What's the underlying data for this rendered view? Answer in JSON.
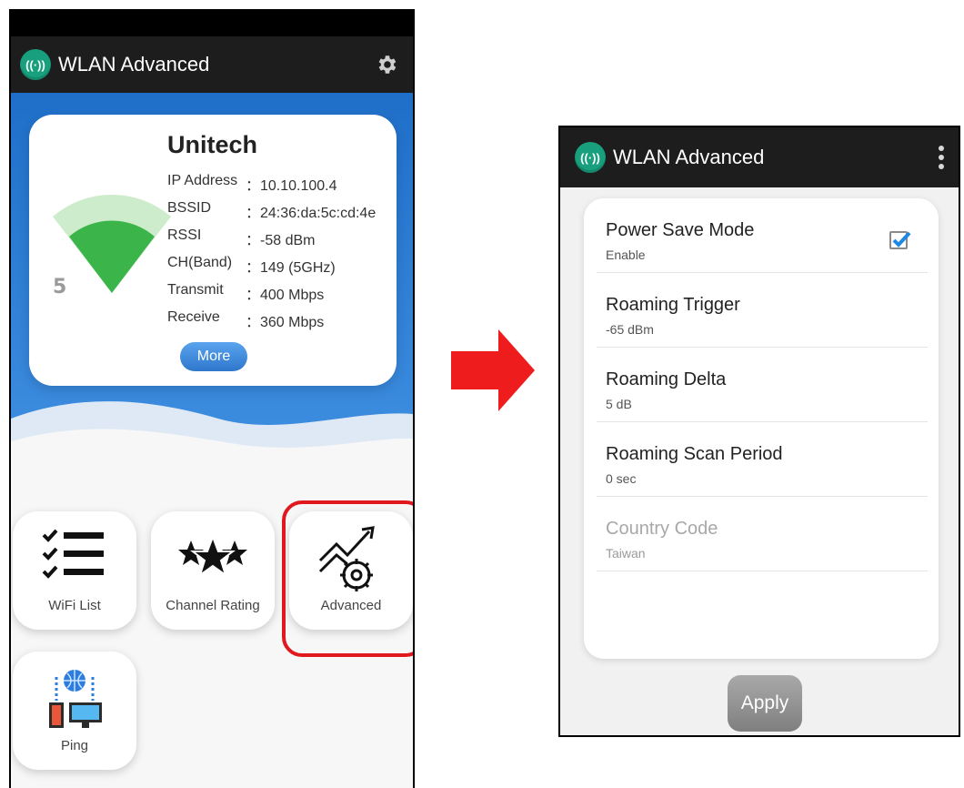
{
  "left_screen": {
    "app_title": "WLAN Advanced",
    "logo_glyph": "((·))",
    "settings_icon": "gear-icon",
    "network": {
      "ssid": "Unitech",
      "rows": [
        {
          "label": "IP Address",
          "value": "：10.10.100.4"
        },
        {
          "label": "BSSID",
          "value": "：24:36:da:5c:cd:4e"
        },
        {
          "label": "RSSI",
          "value": "：-58 dBm"
        },
        {
          "label": "CH(Band)",
          "value": "：149 (5GHz)"
        },
        {
          "label": "Transmit",
          "value": "：400 Mbps"
        },
        {
          "label": "Receive",
          "value": "：360 Mbps"
        }
      ],
      "band_badge": "5",
      "more_label": "More"
    },
    "tiles": [
      {
        "label": "WiFi List",
        "icon": "checklist-icon"
      },
      {
        "label": "Channel Rating",
        "icon": "stars-icon"
      },
      {
        "label": "Advanced",
        "icon": "advanced-gear-chart-icon"
      },
      {
        "label": "Ping",
        "icon": "network-computers-icon"
      }
    ]
  },
  "right_screen": {
    "app_title": "WLAN Advanced",
    "logo_glyph": "((·))",
    "settings": [
      {
        "title": "Power Save Mode",
        "value": "Enable",
        "checked": true
      },
      {
        "title": "Roaming Trigger",
        "value": "-65 dBm"
      },
      {
        "title": "Roaming Delta",
        "value": "5 dB"
      },
      {
        "title": "Roaming Scan Period",
        "value": "0 sec"
      },
      {
        "title": "Country Code",
        "value": "Taiwan",
        "disabled": true
      }
    ],
    "apply_label": "Apply"
  },
  "colors": {
    "accent_blue": "#1f6fc9",
    "logo_green": "#18a07e",
    "highlight_red": "#e0191f",
    "arrow_red": "#ee1c1c",
    "check_blue": "#1e88e5"
  }
}
